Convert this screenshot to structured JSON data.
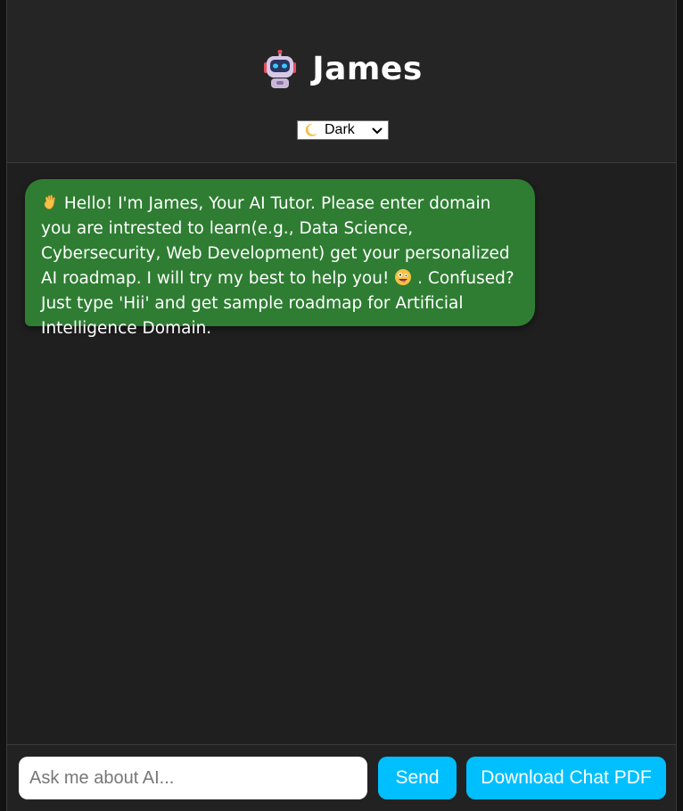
{
  "header": {
    "title": "James",
    "icon": "robot-icon",
    "theme_select": {
      "selected": "Dark",
      "icon": "crescent-moon-icon"
    }
  },
  "messages": [
    {
      "sender": "bot",
      "lead_icon": "waving-hand-icon",
      "text_before_emoji": "Hello! I'm James, Your AI Tutor. Please enter domain you are intrested to learn(e.g., Data Science, Cybersecurity, Web Development) get your personalized AI roadmap. I will try my best to help you!",
      "inline_icon": "zany-face-icon",
      "text_after_emoji": ". Confused? Just type 'Hii' and get sample roadmap for Artificial Intelligence Domain."
    }
  ],
  "input": {
    "placeholder": "Ask me about AI...",
    "value": ""
  },
  "buttons": {
    "send": "Send",
    "download": "Download Chat PDF"
  },
  "colors": {
    "background": "#1f1f1f",
    "header_bg": "#252525",
    "bubble_bg": "#2e7d32",
    "accent": "#00bfff"
  }
}
